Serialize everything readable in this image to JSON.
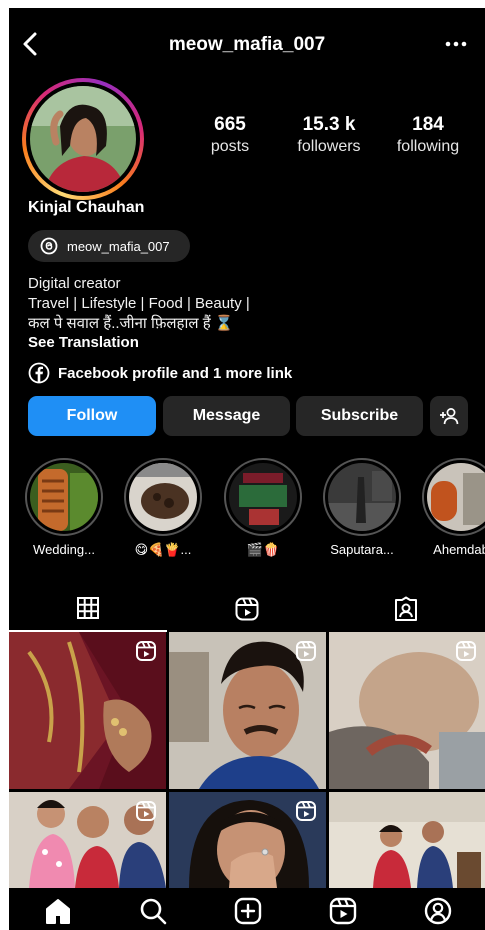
{
  "header": {
    "username": "meow_mafia_007"
  },
  "profile": {
    "display_name": "Kinjal Chauhan",
    "threads_handle": "meow_mafia_007",
    "stats": [
      {
        "value": "665",
        "label": "posts"
      },
      {
        "value": "15.3 k",
        "label": "followers"
      },
      {
        "value": "184",
        "label": "following"
      }
    ],
    "bio": {
      "category": "Digital creator",
      "line1": "Travel | Lifestyle | Food | Beauty |",
      "line2": "कल पे सवाल हैं..जीना फ़िलहाल हैं ⌛"
    },
    "see_translation": "See Translation",
    "link_text": "Facebook profile and 1 more link"
  },
  "actions": {
    "follow": "Follow",
    "message": "Message",
    "subscribe": "Subscribe"
  },
  "highlights": [
    {
      "caption": "Wedding..."
    },
    {
      "caption": "😋🍕🍟..."
    },
    {
      "caption": "🎬🍿"
    },
    {
      "caption": "Saputara..."
    },
    {
      "caption": "Ahemdab"
    }
  ],
  "tabs": [
    "grid-icon",
    "reels-icon",
    "tagged-icon"
  ],
  "nav_icons": [
    "home-icon",
    "search-icon",
    "create-icon",
    "reels-icon",
    "profile-icon"
  ],
  "colors": {
    "follow_blue": "#1f8ff5",
    "background": "#000000",
    "chip_bg": "#262626"
  }
}
